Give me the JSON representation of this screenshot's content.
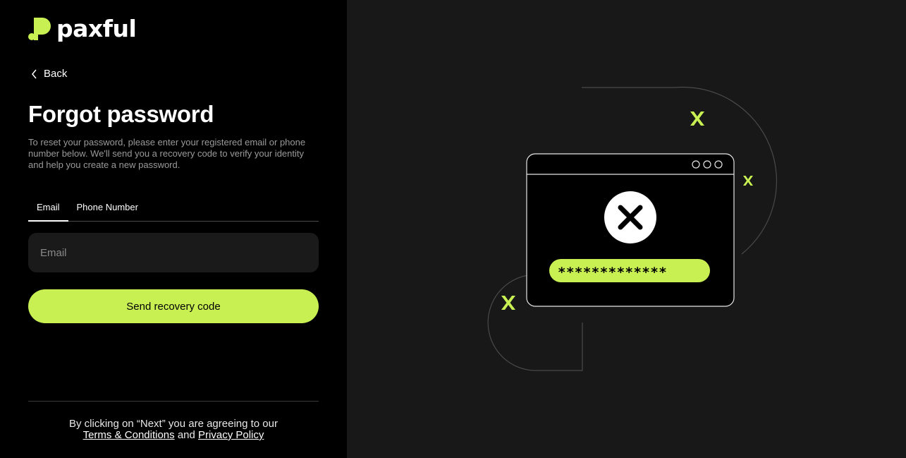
{
  "brand": {
    "name": "paxful",
    "accent": "#c8f053"
  },
  "nav": {
    "back_label": "Back",
    "back_icon": "chevron-left-icon"
  },
  "page": {
    "title": "Forgot password",
    "description": "To reset your password, please enter your registered email or phone number below. We'll send you a recovery code to verify your identity and help you create a new password."
  },
  "tabs": [
    {
      "label": "Email",
      "active": true
    },
    {
      "label": "Phone Number",
      "active": false
    }
  ],
  "form": {
    "email_placeholder": "Email",
    "email_value": "",
    "submit_label": "Send recovery code"
  },
  "footer": {
    "prefix": "By clicking on “Next” you are agreeing to our",
    "terms_label": "Terms & Conditions",
    "and": "and",
    "privacy_label": "Privacy Policy"
  },
  "illustration": {
    "password_mask": "*************",
    "icons": [
      "close-circle-icon",
      "sparkle-x-icon"
    ]
  }
}
